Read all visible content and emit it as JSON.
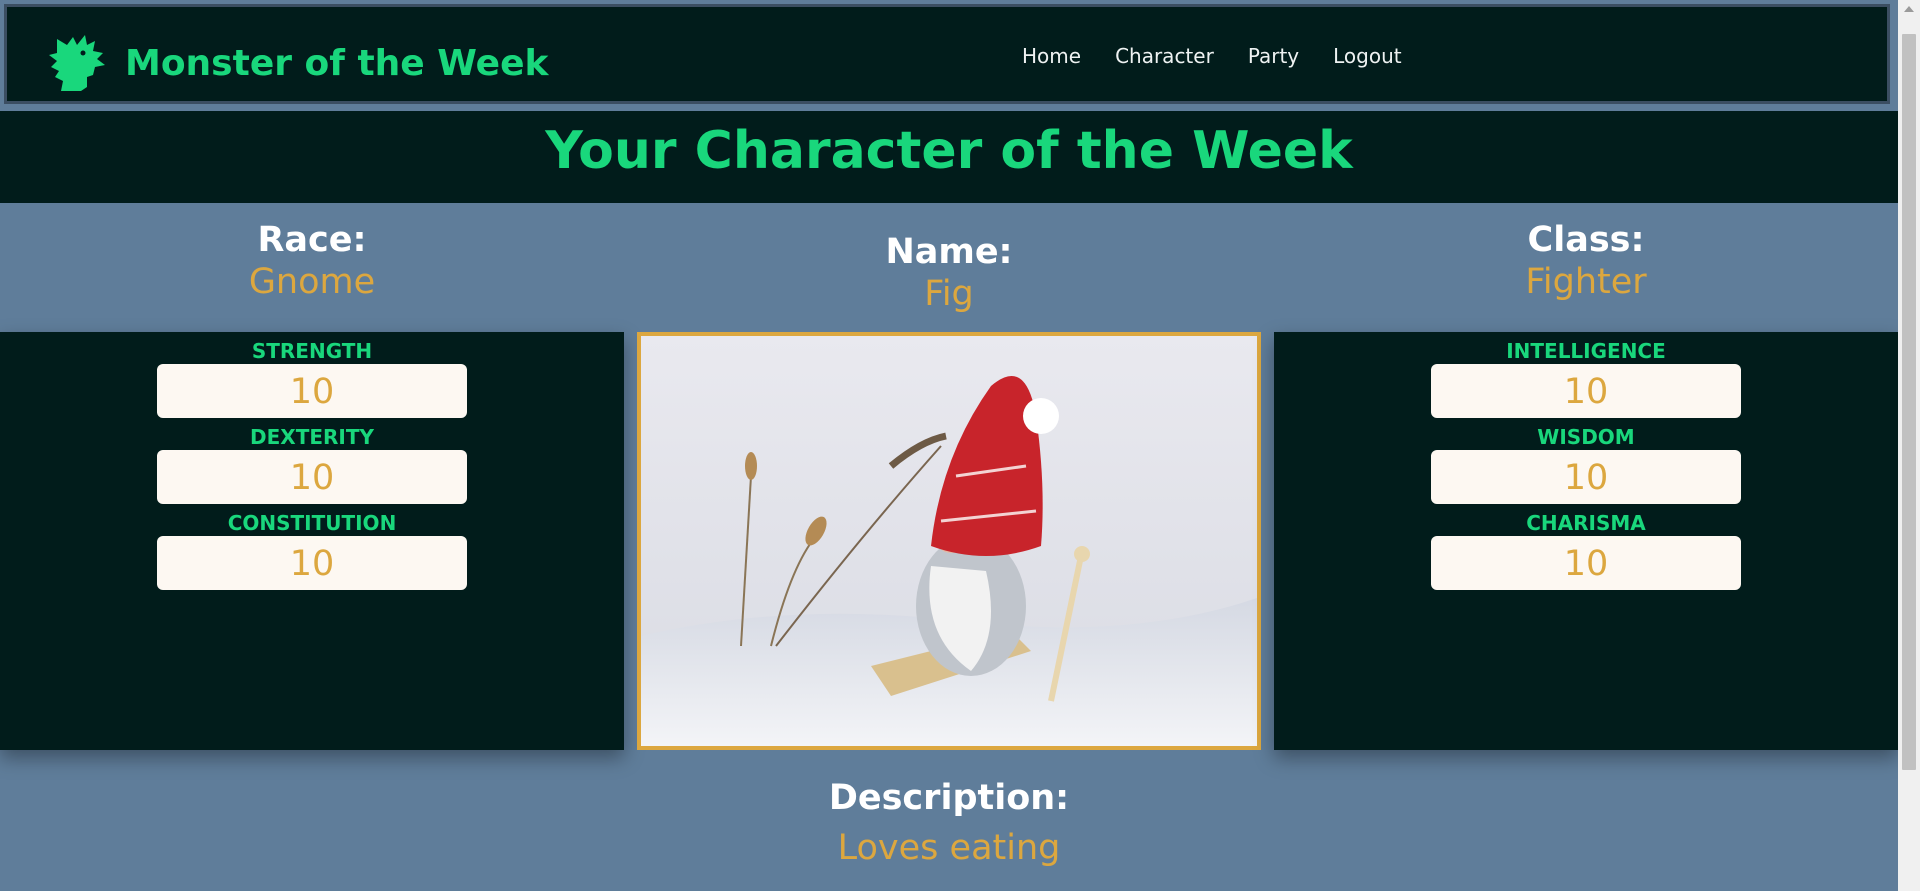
{
  "app": {
    "title": "Monster of the Week"
  },
  "nav": [
    {
      "label": "Home"
    },
    {
      "label": "Character"
    },
    {
      "label": "Party"
    },
    {
      "label": "Logout"
    }
  ],
  "hero": {
    "heading": "Your Character of the Week"
  },
  "character": {
    "race": {
      "label": "Race:",
      "value": "Gnome"
    },
    "name": {
      "label": "Name:",
      "value": "Fig"
    },
    "class": {
      "label": "Class:",
      "value": "Fighter"
    },
    "description": {
      "label": "Description:",
      "value": "Loves eating"
    }
  },
  "stats_left": [
    {
      "label": "STRENGTH",
      "value": "10"
    },
    {
      "label": "DEXTERITY",
      "value": "10"
    },
    {
      "label": "CONSTITUTION",
      "value": "10"
    }
  ],
  "stats_right": [
    {
      "label": "INTELLIGENCE",
      "value": "10"
    },
    {
      "label": "WISDOM",
      "value": "10"
    },
    {
      "label": "CHARISMA",
      "value": "10"
    }
  ],
  "icons": {
    "logo": "dragon-head-icon"
  },
  "colors": {
    "accent_green": "#19d77c",
    "gold": "#dca73f",
    "dark_panel": "#011c1b",
    "page_bg": "#5f7d9a"
  }
}
